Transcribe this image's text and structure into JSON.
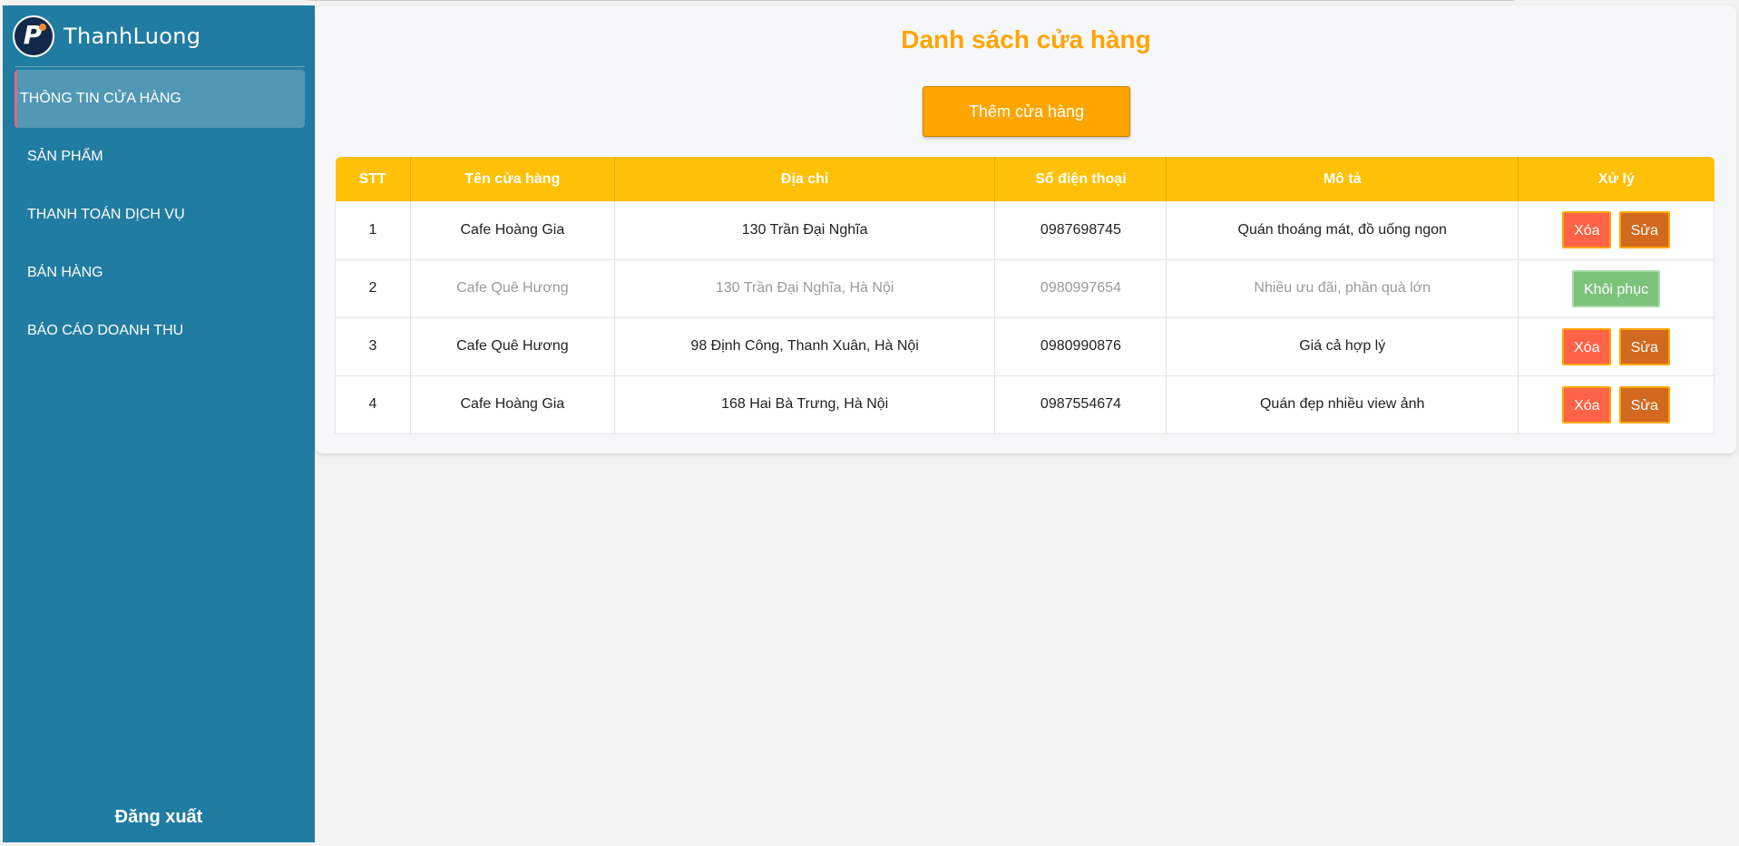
{
  "sidebar": {
    "brand_name": "ThanhLuong",
    "logo_letter": "P",
    "items": [
      {
        "label": "THÔNG TIN CỬA HÀNG",
        "active": true
      },
      {
        "label": "SẢN PHẨM",
        "active": false
      },
      {
        "label": "THANH TOÁN DỊCH VỤ",
        "active": false
      },
      {
        "label": "BÁN HÀNG",
        "active": false
      },
      {
        "label": "BÁO CÁO DOANH THU",
        "active": false
      }
    ],
    "logout_label": "Đăng xuất"
  },
  "main": {
    "title": "Danh sách cửa hàng",
    "add_button_label": "Thêm cửa hàng",
    "table": {
      "headers": [
        "STT",
        "Tên cửa hàng",
        "Địa chỉ",
        "Số điện thoại",
        "Mô tả",
        "Xử lý"
      ],
      "rows": [
        {
          "stt": "1",
          "name": "Cafe Hoàng Gia",
          "address": "130 Trần Đại Nghĩa",
          "phone": "0987698745",
          "description": "Quán thoáng mát, đồ uống ngon",
          "deleted": false
        },
        {
          "stt": "2",
          "name": "Cafe Quê Hương",
          "address": "130 Trần Đại Nghĩa, Hà Nội",
          "phone": "0980997654",
          "description": "Nhiều ưu đãi, phần quà lớn",
          "deleted": true
        },
        {
          "stt": "3",
          "name": "Cafe Quê Hương",
          "address": "98 Định Công, Thanh Xuân, Hà Nội",
          "phone": "0980990876",
          "description": "Giá cả hợp lý",
          "deleted": false
        },
        {
          "stt": "4",
          "name": "Cafe Hoàng Gia",
          "address": "168 Hai Bà Trưng, Hà Nội",
          "phone": "0987554674",
          "description": "Quán đẹp nhiều view ảnh",
          "deleted": false
        }
      ]
    },
    "actions": {
      "delete_label": "Xóa",
      "edit_label": "Sửa",
      "restore_label": "Khôi phục"
    }
  },
  "colors": {
    "sidebar_bg": "#217ca1",
    "accent_orange": "#ffa500",
    "table_header_bg": "#ffc107",
    "delete_button": "#ff6347",
    "edit_button": "#d2691e",
    "restore_button": "#7cc37a"
  }
}
